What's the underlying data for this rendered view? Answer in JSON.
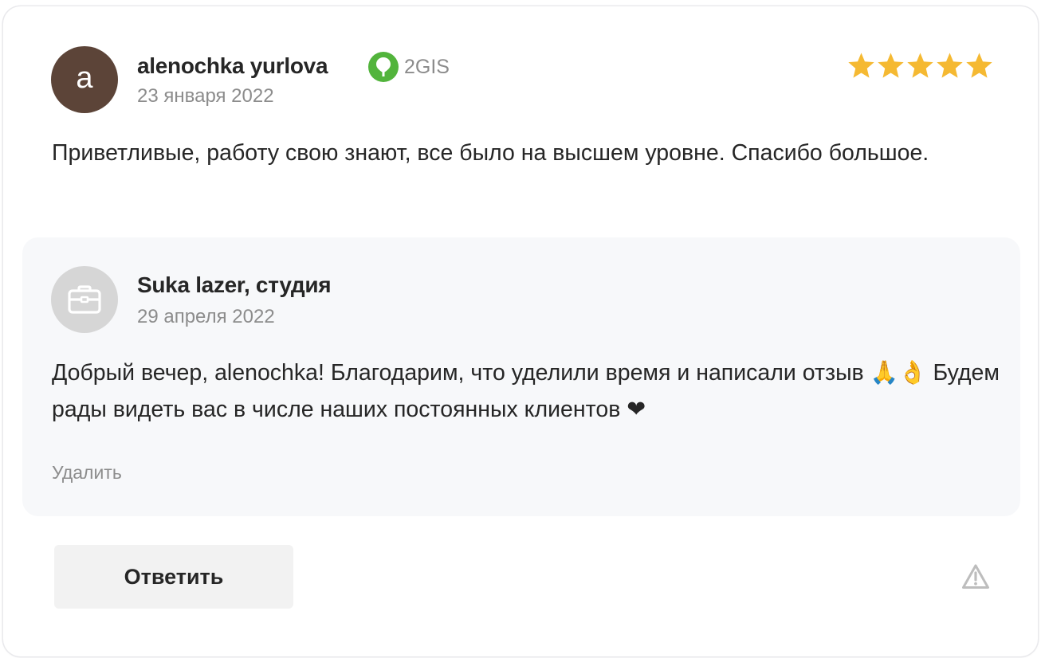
{
  "review": {
    "avatar_letter": "a",
    "author": "alenochka yurlova",
    "source_label": "2GIS",
    "date": "23 января 2022",
    "rating": 5,
    "rating_max": 5,
    "star_color": "#f5b932",
    "text": "Приветливые, работу свою знают, все было на высшем уровне. Спасибо большое."
  },
  "reply": {
    "avatar_icon": "briefcase-icon",
    "author": "Suka lazer, студия",
    "date": "29 апреля 2022",
    "text": "Добрый вечер, alenochka! Благодарим, что уделили время и написали отзыв 🙏👌 Будем рады видеть вас в числе наших постоянных клиентов ❤",
    "delete_label": "Удалить"
  },
  "actions": {
    "reply_label": "Ответить",
    "report_icon": "warning-icon"
  }
}
